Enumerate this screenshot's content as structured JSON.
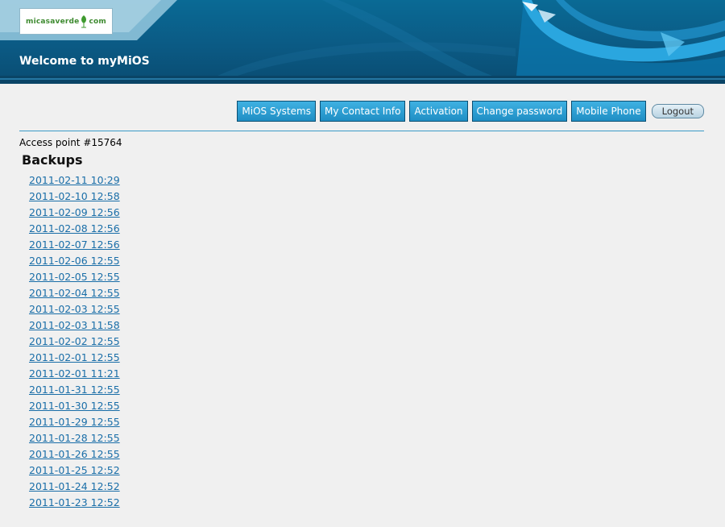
{
  "header": {
    "logo_text_left": "micasaverde",
    "logo_text_right": "com",
    "logo_icon": "leaf-icon",
    "title": "Welcome to myMiOS"
  },
  "nav": {
    "items": [
      {
        "label": "MiOS Systems"
      },
      {
        "label": "My Contact Info"
      },
      {
        "label": "Activation"
      },
      {
        "label": "Change password"
      },
      {
        "label": "Mobile Phone"
      }
    ],
    "logout_label": "Logout"
  },
  "main": {
    "access_point": "Access point #15764",
    "backups_title": "Backups",
    "backups": [
      "2011-02-11 10:29",
      "2011-02-10 12:58",
      "2011-02-09 12:56",
      "2011-02-08 12:56",
      "2011-02-07 12:56",
      "2011-02-06 12:55",
      "2011-02-05 12:55",
      "2011-02-04 12:55",
      "2011-02-03 12:55",
      "2011-02-03 11:58",
      "2011-02-02 12:55",
      "2011-02-01 12:55",
      "2011-02-01 11:21",
      "2011-01-31 12:55",
      "2011-01-30 12:55",
      "2011-01-29 12:55",
      "2011-01-28 12:55",
      "2011-01-26 12:55",
      "2011-01-25 12:52",
      "2011-01-24 12:52",
      "2011-01-23 12:52"
    ]
  },
  "colors": {
    "link": "#1a6ea8",
    "nav_button": "#2a9fd6",
    "header_bg": "#0b5a84",
    "divider": "#3b9ac7"
  }
}
